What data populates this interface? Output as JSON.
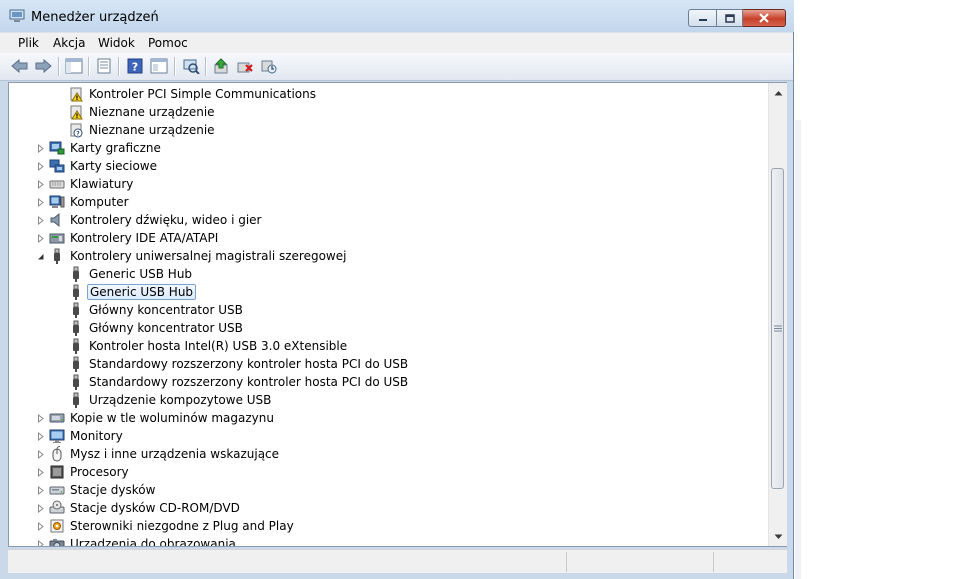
{
  "window": {
    "title": "Menedżer urządzeń",
    "title_icon": "device-manager-icon",
    "caption_buttons": [
      "minimize-icon",
      "maximize-icon",
      "close-icon"
    ]
  },
  "menu": {
    "items": [
      {
        "label": "Plik"
      },
      {
        "label": "Akcja"
      },
      {
        "label": "Widok"
      },
      {
        "label": "Pomoc"
      }
    ]
  },
  "toolbar": {
    "buttons": [
      "back-arrow-icon",
      "forward-arrow-icon",
      "console-tree-icon",
      "properties-icon",
      "help-icon",
      "view-icon",
      "scan-hardware-icon",
      "update-driver-icon",
      "uninstall-icon",
      "enable-device-icon"
    ]
  },
  "tree": {
    "rows": [
      {
        "label": "Kontroler PCI Simple Communications",
        "icon": "warning-device-icon",
        "level": 2,
        "expander": "none"
      },
      {
        "label": "Nieznane urządzenie",
        "icon": "warning-device-icon",
        "level": 2,
        "expander": "none"
      },
      {
        "label": "Nieznane urządzenie",
        "icon": "unknown-device-icon",
        "level": 2,
        "expander": "none"
      },
      {
        "label": "Karty graficzne",
        "icon": "display-adapter-icon",
        "level": 1,
        "expander": "collapsed"
      },
      {
        "label": "Karty sieciowe",
        "icon": "network-adapter-icon",
        "level": 1,
        "expander": "collapsed"
      },
      {
        "label": "Klawiatury",
        "icon": "keyboard-icon",
        "level": 1,
        "expander": "collapsed"
      },
      {
        "label": "Komputer",
        "icon": "computer-icon",
        "level": 1,
        "expander": "collapsed"
      },
      {
        "label": "Kontrolery dźwięku, wideo i gier",
        "icon": "speaker-icon",
        "level": 1,
        "expander": "collapsed"
      },
      {
        "label": "Kontrolery IDE ATA/ATAPI",
        "icon": "ide-controller-icon",
        "level": 1,
        "expander": "collapsed"
      },
      {
        "label": "Kontrolery uniwersalnej magistrali szeregowej",
        "icon": "usb-icon",
        "level": 1,
        "expander": "expanded"
      },
      {
        "label": "Generic USB Hub",
        "icon": "usb-icon",
        "level": 2,
        "expander": "none"
      },
      {
        "label": "Generic USB Hub",
        "icon": "usb-icon",
        "level": 2,
        "expander": "none",
        "selected": true
      },
      {
        "label": "Główny koncentrator USB",
        "icon": "usb-icon",
        "level": 2,
        "expander": "none"
      },
      {
        "label": "Główny koncentrator USB",
        "icon": "usb-icon",
        "level": 2,
        "expander": "none"
      },
      {
        "label": "Kontroler hosta Intel(R) USB 3.0 eXtensible",
        "icon": "usb-icon",
        "level": 2,
        "expander": "none"
      },
      {
        "label": "Standardowy rozszerzony kontroler hosta PCI do USB",
        "icon": "usb-icon",
        "level": 2,
        "expander": "none"
      },
      {
        "label": "Standardowy rozszerzony kontroler hosta PCI do USB",
        "icon": "usb-icon",
        "level": 2,
        "expander": "none"
      },
      {
        "label": "Urządzenie kompozytowe USB",
        "icon": "usb-icon",
        "level": 2,
        "expander": "none"
      },
      {
        "label": "Kopie w tle woluminów magazynu",
        "icon": "storage-volume-icon",
        "level": 1,
        "expander": "collapsed"
      },
      {
        "label": "Monitory",
        "icon": "monitor-icon",
        "level": 1,
        "expander": "collapsed"
      },
      {
        "label": "Mysz i inne urządzenia wskazujące",
        "icon": "mouse-icon",
        "level": 1,
        "expander": "collapsed"
      },
      {
        "label": "Procesory",
        "icon": "processor-icon",
        "level": 1,
        "expander": "collapsed"
      },
      {
        "label": "Stacje dysków",
        "icon": "disk-drive-icon",
        "level": 1,
        "expander": "collapsed"
      },
      {
        "label": "Stacje dysków CD-ROM/DVD",
        "icon": "cdrom-icon",
        "level": 1,
        "expander": "collapsed"
      },
      {
        "label": "Sterowniki niezgodne z Plug and Play",
        "icon": "non-pnp-driver-icon",
        "level": 1,
        "expander": "collapsed"
      },
      {
        "label": "Urządzenia do obrazowania",
        "icon": "imaging-device-icon",
        "level": 1,
        "expander": "collapsed"
      }
    ]
  },
  "colors": {
    "selection_border": "#7da2ce",
    "selection_fill": "#dcebfc",
    "close_button": "#c8412b",
    "window_frame": "#c9d9ea"
  }
}
